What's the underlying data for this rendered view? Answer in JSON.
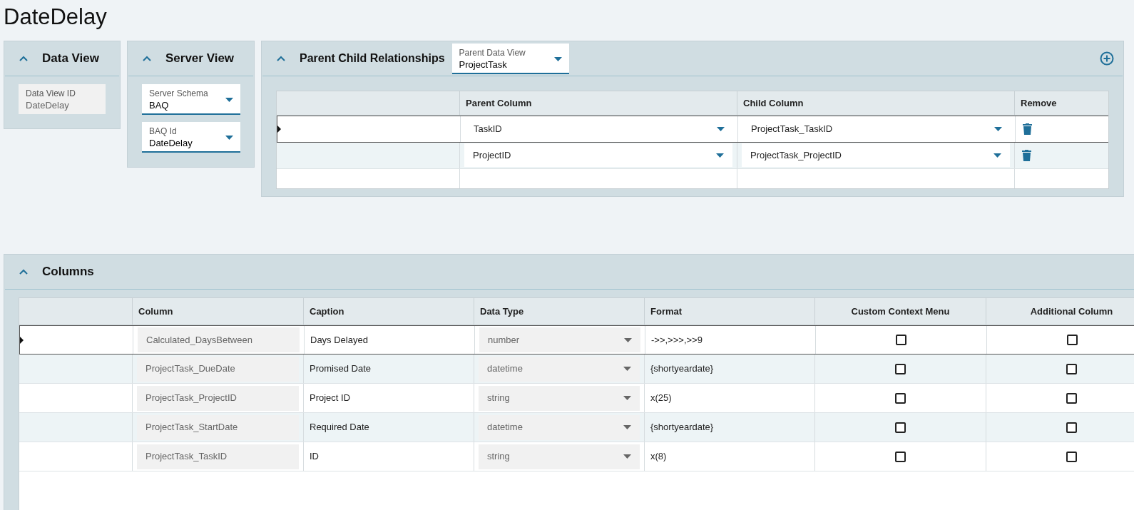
{
  "page_title": "DateDelay",
  "data_view": {
    "title": "Data View",
    "expanded": true,
    "field": {
      "label": "Data View ID",
      "value": "DateDelay"
    }
  },
  "server_view": {
    "title": "Server View",
    "expanded": true,
    "fields": [
      {
        "label": "Server Schema",
        "value": "BAQ"
      },
      {
        "label": "BAQ Id",
        "value": "DateDelay"
      }
    ]
  },
  "relationships": {
    "title": "Parent Child Relationships",
    "expanded": true,
    "parent_data_view": {
      "label": "Parent Data View",
      "value": "ProjectTask"
    },
    "columns": [
      "Parent Column",
      "Child Column",
      "Remove"
    ],
    "rows": [
      {
        "selected": true,
        "parent_column": "TaskID",
        "child_column": "ProjectTask_TaskID"
      },
      {
        "selected": false,
        "parent_column": "ProjectID",
        "child_column": "ProjectTask_ProjectID"
      }
    ]
  },
  "columns_panel": {
    "title": "Columns",
    "expanded": true,
    "columns": [
      "Column",
      "Caption",
      "Data Type",
      "Format",
      "Custom Context Menu",
      "Additional Column"
    ],
    "rows": [
      {
        "selected": true,
        "column": "Calculated_DaysBetween",
        "caption": "Days Delayed",
        "data_type": "number",
        "format": "->>,>>>,>>9",
        "custom_context_menu": false,
        "additional_column": false
      },
      {
        "selected": false,
        "column": "ProjectTask_DueDate",
        "caption": "Promised Date",
        "data_type": "datetime",
        "format": "{shortyeardate}",
        "custom_context_menu": false,
        "additional_column": false
      },
      {
        "selected": false,
        "column": "ProjectTask_ProjectID",
        "caption": "Project ID",
        "data_type": "string",
        "format": "x(25)",
        "custom_context_menu": false,
        "additional_column": false
      },
      {
        "selected": false,
        "column": "ProjectTask_StartDate",
        "caption": "Required Date",
        "data_type": "datetime",
        "format": "{shortyeardate}",
        "custom_context_menu": false,
        "additional_column": false
      },
      {
        "selected": false,
        "column": "ProjectTask_TaskID",
        "caption": "ID",
        "data_type": "string",
        "format": "x(8)",
        "custom_context_menu": false,
        "additional_column": false
      }
    ]
  }
}
